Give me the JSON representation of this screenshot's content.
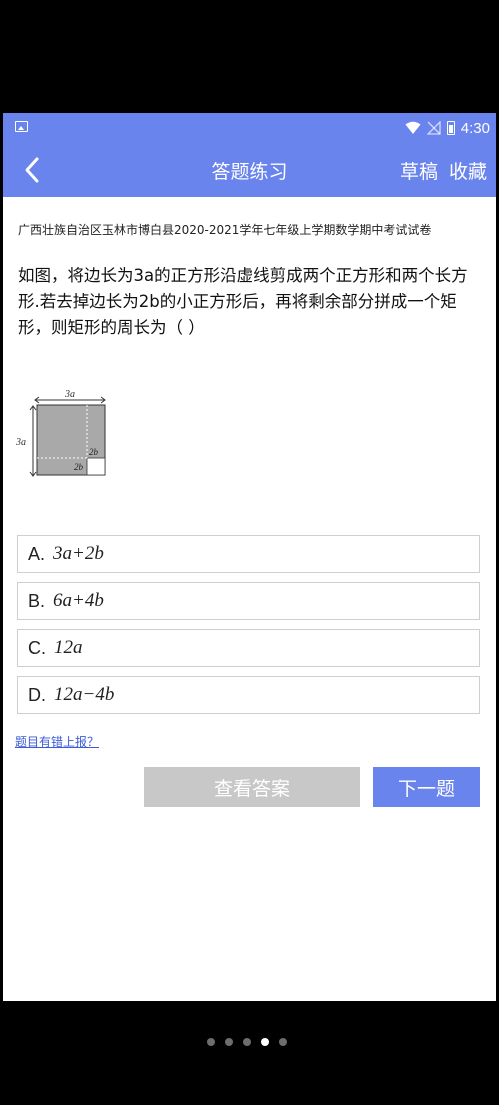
{
  "status_bar": {
    "time": "4:30"
  },
  "title_bar": {
    "title": "答题练习",
    "draft_label": "草稿",
    "favorite_label": "收藏"
  },
  "question": {
    "source": "广西壮族自治区玉林市博白县2020-2021学年七年级上学期数学期中考试试卷",
    "text": "如图，将边长为3a的正方形沿虚线剪成两个正方形和两个长方形.若去掉边长为2b的小正方形后，再将剩余部分拼成一个矩形，则矩形的周长为（    ）",
    "figure": {
      "top_label": "3a",
      "left_label": "3a",
      "inner_label_right": "2b",
      "inner_label_bottom": "2b"
    }
  },
  "options": [
    {
      "letter": "A.",
      "text": "3a+2b"
    },
    {
      "letter": "B.",
      "text": "6a+4b"
    },
    {
      "letter": "C.",
      "text": "12a"
    },
    {
      "letter": "D.",
      "text": "12a−4b"
    }
  ],
  "report_link": "题目有错上报？",
  "buttons": {
    "view_answer": "查看答案",
    "next_question": "下一题"
  },
  "pager": {
    "count": 5,
    "active_index": 3
  }
}
